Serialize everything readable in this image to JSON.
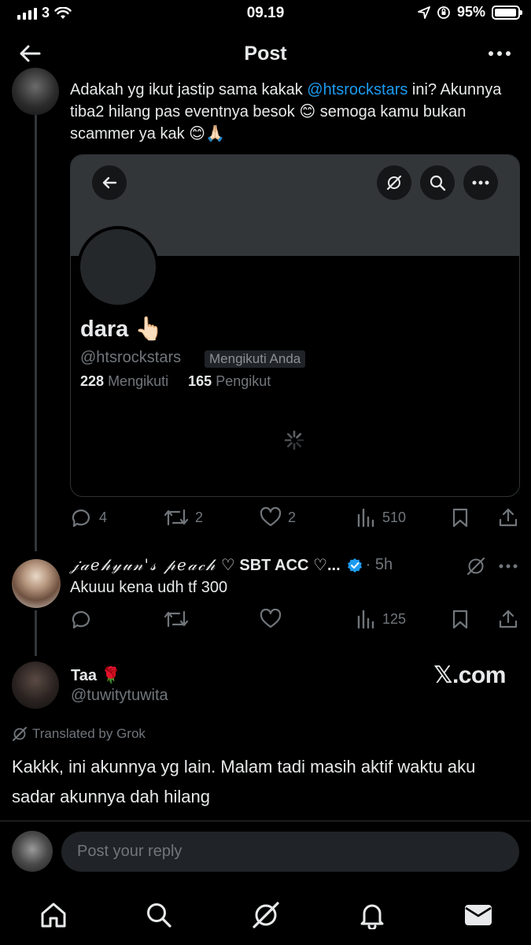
{
  "status_bar": {
    "carrier": "3",
    "time": "09.19",
    "battery_percent": "95%",
    "battery_level": 0.95
  },
  "header": {
    "title": "Post",
    "back_icon": "arrow-left-icon",
    "more_icon": "more-horizontal-icon"
  },
  "main_post": {
    "text_before_mention": "Adakah yg ikut jastip sama kakak ",
    "mention": "@htsrockstars",
    "text_after_mention": " ini? Akunnya tiba2 hilang pas eventnya besok 😊 semoga kamu bukan scammer ya kak 😊🙏🏻",
    "card": {
      "name": "dara 👆🏻",
      "handle": "@htsrockstars",
      "follows_you": "Mengikuti Anda",
      "following_count": "228",
      "following_label": "Mengikuti",
      "followers_count": "165",
      "followers_label": "Pengikut"
    },
    "actions": {
      "replies": "4",
      "reposts": "2",
      "likes": "2",
      "views": "510"
    }
  },
  "reply": {
    "name_fancy": "𝒿𝒶𝑒𝒽𝓎𝓊𝓃'𝓈 𝓅𝑒𝒶𝒸𝒽",
    "name_suffix": " ♡ SBT ACC ♡...",
    "time": "· 5h",
    "text": "Akuuu kena udh tf 300",
    "actions": {
      "views": "125"
    }
  },
  "screenshot_user": {
    "name": "Taa 🌹",
    "handle": "@tuwitytuwita",
    "watermark": "𝕏.com",
    "translated_label": "Translated by Grok",
    "text": "Kakkk, ini akunnya yg lain. Malam tadi masih aktif waktu aku sadar akunnya dah hilang"
  },
  "reply_bar": {
    "placeholder": "Post your reply"
  },
  "colors": {
    "accent": "#1d9bf0",
    "text": "#e7e9ea",
    "muted": "#71767b",
    "background": "#000000"
  }
}
